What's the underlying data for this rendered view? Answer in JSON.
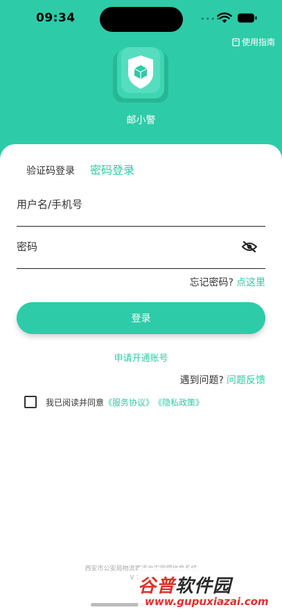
{
  "status_bar": {
    "time": "09:34",
    "signal_dots": "••••"
  },
  "header": {
    "guide_label": "使用指南",
    "app_name": "邮小警"
  },
  "login": {
    "tab_sms": "验证码登录",
    "tab_password": "密码登录",
    "username_placeholder": "用户名/手机号",
    "password_placeholder": "密码",
    "forgot_text": "忘记密码?",
    "forgot_link": "点这里",
    "login_button": "登录",
    "apply_account": "申请开通账号",
    "problem_text": "遇到问题?",
    "problem_link": "问题反馈",
    "agree_text": "我已阅读并同意",
    "service_agreement": "《服务协议》",
    "privacy_policy": "《隐私政策》"
  },
  "footer": {
    "org": "西安市公安局物流寄递治安管理信息系统",
    "version": "V 1.0.0"
  },
  "watermark": {
    "title_part1": "谷普",
    "title_part2": "软件园",
    "url": "www.gupuxiazai.com"
  },
  "colors": {
    "accent": "#2ecba8",
    "text": "#333333"
  }
}
